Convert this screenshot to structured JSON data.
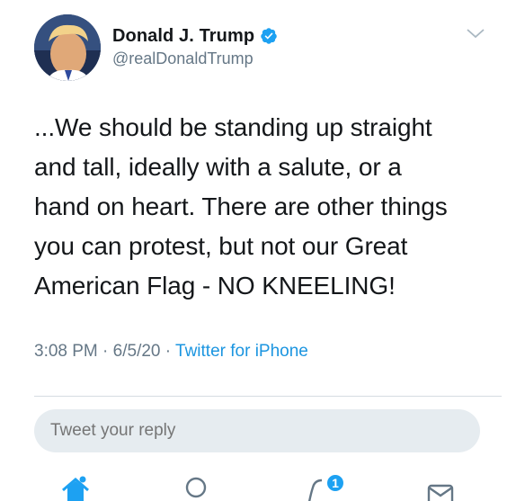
{
  "tweet": {
    "author": {
      "display_name": "Donald J. Trump",
      "handle": "@realDonaldTrump",
      "verified": true,
      "verified_icon": "verified-badge-icon"
    },
    "text": "...We should be standing up straight\nand tall, ideally with a salute, or a\nhand on heart. There are other things\nyou can protest, but not our Great\nAmerican Flag - NO KNEELING!",
    "time": "3:08 PM",
    "date": "6/5/20",
    "separator": " · ",
    "source": "Twitter for iPhone"
  },
  "reply": {
    "placeholder": "Tweet your reply"
  },
  "tabbar": {
    "items": [
      {
        "name": "home",
        "icon": "home-icon"
      },
      {
        "name": "search",
        "icon": "search-icon"
      },
      {
        "name": "notifications",
        "icon": "bell-icon",
        "badge": "1"
      },
      {
        "name": "messages",
        "icon": "mail-icon"
      }
    ]
  },
  "colors": {
    "accent": "#1da1f2",
    "link": "#1b95e0",
    "secondary_text": "#657786",
    "reply_bg": "#e6ecf0"
  }
}
